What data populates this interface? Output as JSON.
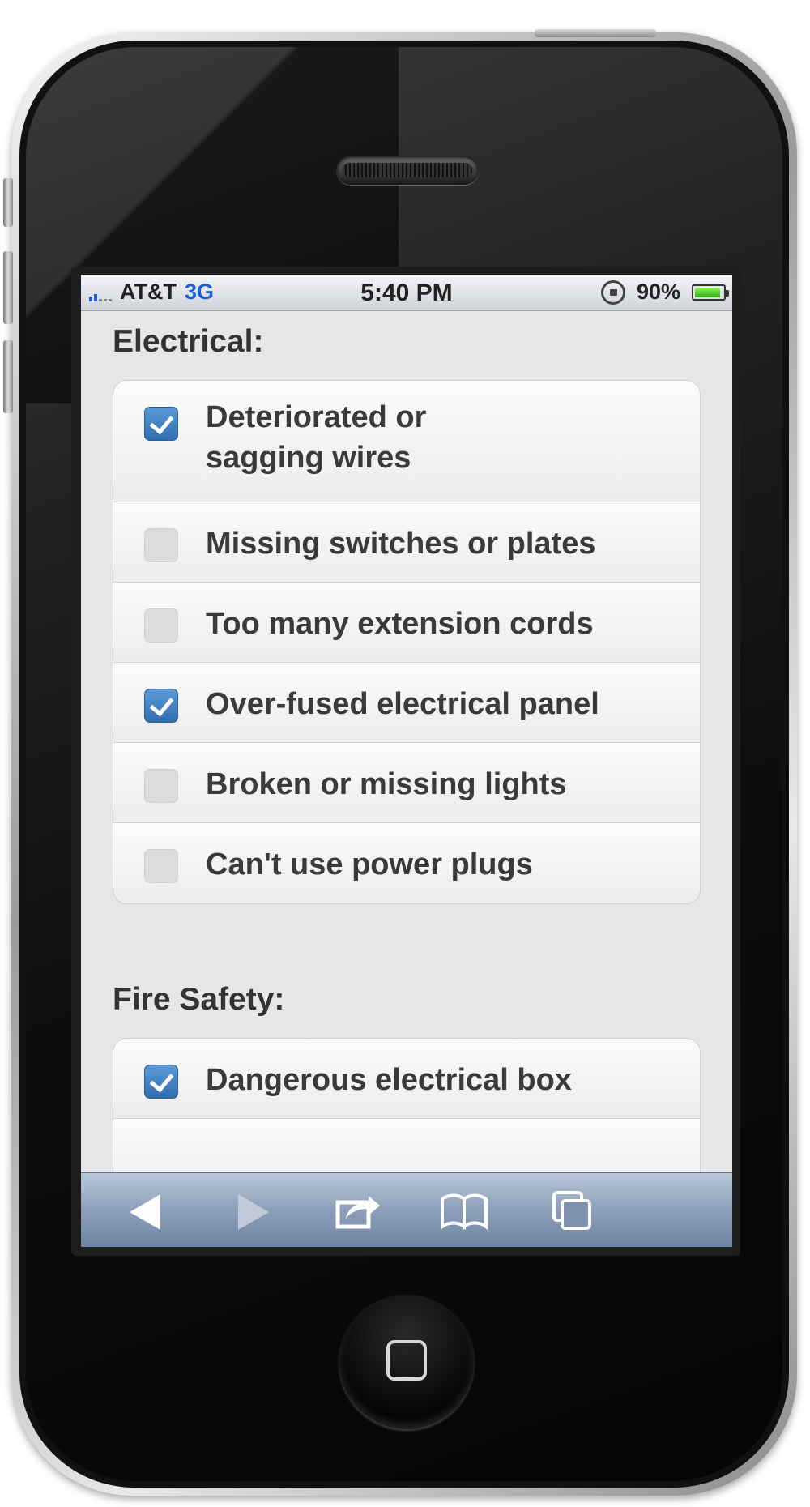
{
  "status_bar": {
    "carrier": "AT&T",
    "network": "3G",
    "time": "5:40 PM",
    "battery": "90%",
    "battery_level": 0.9,
    "signal_bars": 2
  },
  "sections": [
    {
      "title": "Electrical:",
      "items": [
        {
          "label": "Deteriorated or sagging wires",
          "checked": true
        },
        {
          "label": "Missing switches or plates",
          "checked": false
        },
        {
          "label": "Too many extension cords",
          "checked": false
        },
        {
          "label": "Over-fused electrical panel",
          "checked": true
        },
        {
          "label": "Broken or missing lights",
          "checked": false
        },
        {
          "label": "Can't use power plugs",
          "checked": false
        }
      ]
    },
    {
      "title": "Fire Safety:",
      "items": [
        {
          "label": "Dangerous electrical box",
          "checked": true
        }
      ]
    }
  ],
  "toolbar": {
    "buttons": [
      "back-arrow-icon",
      "forward-arrow-icon",
      "share-icon",
      "bookmarks-icon",
      "tabs-icon"
    ]
  },
  "colors": {
    "checkbox_checked": "#3c7dc2",
    "network_text": "#1d5fd6",
    "battery_fill": "#4cd123",
    "toolbar": "#8c9fb9"
  }
}
